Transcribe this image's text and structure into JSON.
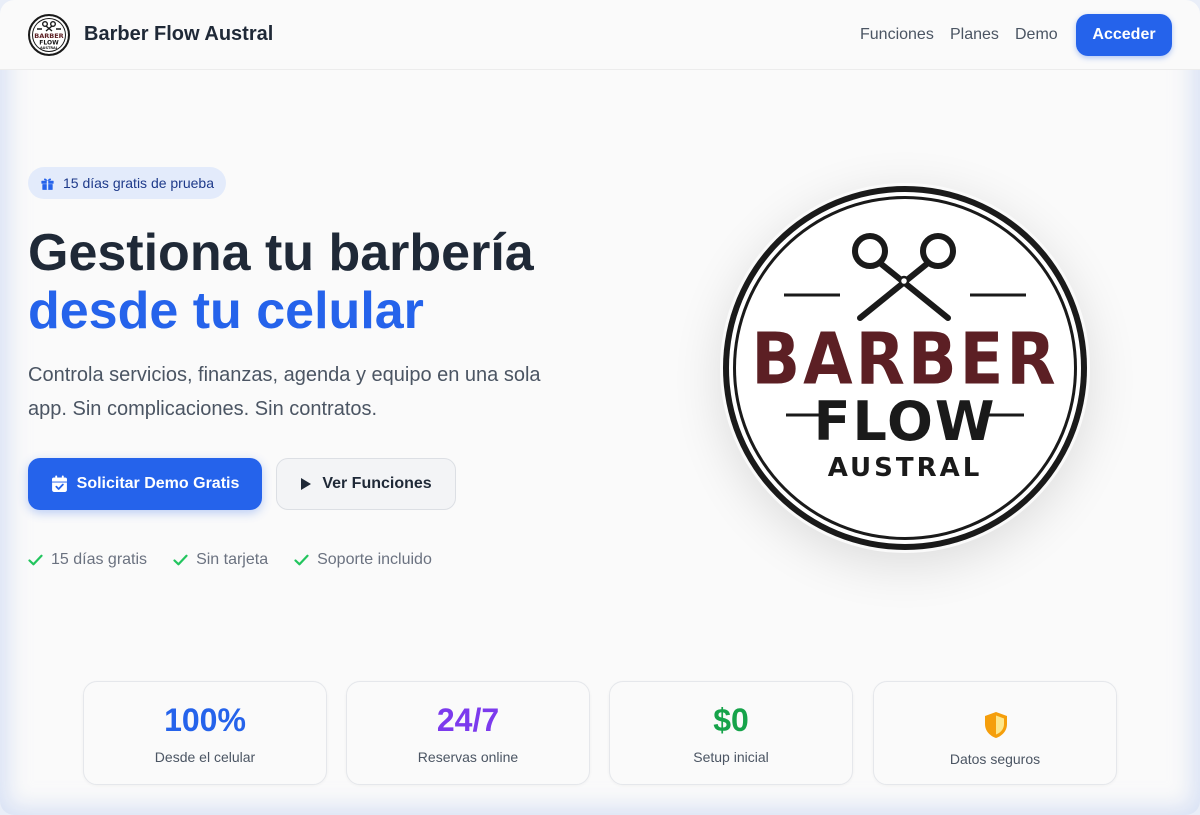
{
  "header": {
    "brand": "Barber Flow Austral",
    "nav": [
      "Funciones",
      "Planes",
      "Demo"
    ],
    "login_label": "Acceder"
  },
  "hero": {
    "badge": "15 días gratis de prueba",
    "title_line1": "Gestiona tu barbería",
    "title_line2": "desde tu celular",
    "subtitle": "Controla servicios, finanzas, agenda y equipo en una sola app. Sin complicaciones. Sin contratos.",
    "primary_cta": "Solicitar Demo Gratis",
    "secondary_cta": "Ver Funciones",
    "checks": [
      "15 días gratis",
      "Sin tarjeta",
      "Soporte incluido"
    ]
  },
  "logo": {
    "line1": "BARBER",
    "line2": "FLOW",
    "line3": "AUSTRAL"
  },
  "stats": [
    {
      "value": "100%",
      "label": "Desde el celular",
      "color": "#2563eb"
    },
    {
      "value": "24/7",
      "label": "Reservas online",
      "color": "#7c3aed"
    },
    {
      "value": "$0",
      "label": "Setup inicial",
      "color": "#16a34a"
    },
    {
      "value": "",
      "label": "Datos seguros",
      "color": "#f59e0b",
      "icon": "shield-icon"
    }
  ],
  "colors": {
    "primary": "#2563eb",
    "dark": "#1f2937",
    "logo_red": "#5c1f24",
    "check_green": "#22c55e"
  }
}
